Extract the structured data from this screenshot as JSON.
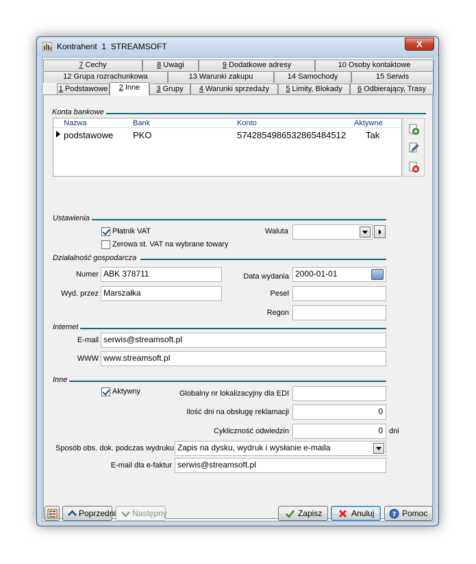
{
  "window": {
    "title": "Kontrahent  1  STREAMSOFT",
    "close_glyph": "X"
  },
  "tabs": {
    "row1": [
      {
        "num": "7",
        "label": "Cechy"
      },
      {
        "num": "8",
        "label": "Uwagi"
      },
      {
        "num": "9",
        "label": "Dodatkowe adresy"
      },
      {
        "num": "10",
        "label": "Osoby kontaktowe"
      }
    ],
    "row2": [
      {
        "num": "12",
        "label": "Grupa rozrachunkowa"
      },
      {
        "num": "13",
        "label": "Warunki zakupu"
      },
      {
        "num": "14",
        "label": "Samochody"
      },
      {
        "num": "15",
        "label": "Serwis"
      }
    ],
    "row3": [
      {
        "num": "1",
        "label": "Podstawowe"
      },
      {
        "num": "2",
        "label": "Inne"
      },
      {
        "num": "3",
        "label": "Grupy"
      },
      {
        "num": "4",
        "label": "Warunki sprzedaży"
      },
      {
        "num": "5",
        "label": "Limity, Blokady"
      },
      {
        "num": "6",
        "label": "Odbierający, Trasy"
      }
    ],
    "active": "2"
  },
  "bank_accounts": {
    "group_label": "Konta bankowe",
    "columns": {
      "name": "Nazwa",
      "bank": "Bank",
      "account": "Konto",
      "active": "Aktywne"
    },
    "rows": [
      {
        "name": "podstawowe",
        "bank": "PKO",
        "account": "5742854986532865484512",
        "active": "Tak"
      }
    ]
  },
  "settings": {
    "group_label": "Ustawienia",
    "vat_payer_label": "Płatnik VAT",
    "vat_payer_checked": true,
    "zero_vat_label": "Zerowa st. VAT na wybrane towary",
    "zero_vat_checked": false,
    "currency_label": "Waluta",
    "currency_value": ""
  },
  "business": {
    "group_label": "Działalność gospodarcza",
    "number_label": "Numer",
    "number_value": "ABK 378711",
    "issued_by_label": "Wyd. przez",
    "issued_by_value": "Marszałka",
    "issue_date_label": "Data wydania",
    "issue_date_value": "2000-01-01",
    "pesel_label": "Pesel",
    "pesel_value": "",
    "regon_label": "Regon",
    "regon_value": ""
  },
  "internet": {
    "group_label": "Internet",
    "email_label": "E-mail",
    "email_value": "serwis@streamsoft.pl",
    "www_label": "WWW",
    "www_value": "www.streamsoft.pl"
  },
  "other": {
    "group_label": "Inne",
    "active_label": "Aktywny",
    "active_checked": true,
    "gln_label": "Globalny nr lokalizacyjny dla EDI",
    "gln_value": "",
    "complaint_days_label": "Ilość dni na obsługę reklamacji",
    "complaint_days_value": "0",
    "visit_freq_label": "Cykliczność odwiedzin",
    "visit_freq_value": "0",
    "visit_freq_unit": "dni",
    "doc_handling_label": "Sposób obs. dok. podczas wydruku",
    "doc_handling_value": "Zapis na dysku, wydruk i wysłanie e-maila",
    "einvoice_email_label": "E-mail dla e-faktur",
    "einvoice_email_value": "serwis@streamsoft.pl"
  },
  "buttons": {
    "prev": "Poprzedni",
    "next": "Następny",
    "save": "Zapisz",
    "cancel": "Anuluj",
    "help": "Pomoc"
  },
  "colors": {
    "group_line": "#0e6a73",
    "header_text": "#0a3a80"
  }
}
